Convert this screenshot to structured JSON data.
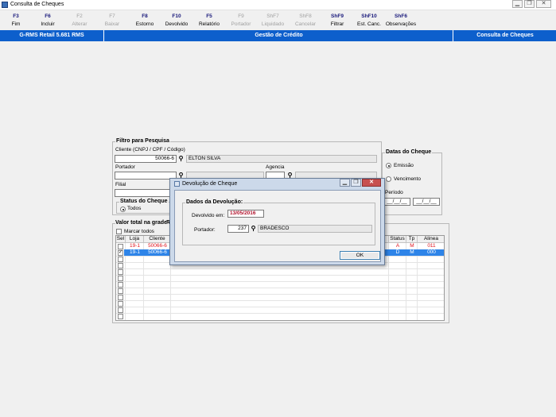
{
  "window": {
    "title": "Consulta de Cheques",
    "buttons": [
      "▁",
      "❐",
      "✕"
    ]
  },
  "toolbar": [
    {
      "key": "F3",
      "label": "Fim",
      "enabled": true
    },
    {
      "key": "F6",
      "label": "Incluir",
      "enabled": true
    },
    {
      "key": "F2",
      "label": "Alterar",
      "enabled": false
    },
    {
      "key": "F7",
      "label": "Baixar",
      "enabled": false
    },
    {
      "key": "F8",
      "label": "Estorno",
      "enabled": true
    },
    {
      "key": "F10",
      "label": "Devolvido",
      "enabled": true
    },
    {
      "key": "F5",
      "label": "Relatório",
      "enabled": true
    },
    {
      "key": "F9",
      "label": "Portador",
      "enabled": false
    },
    {
      "key": "ShF7",
      "label": "Liquidado",
      "enabled": false
    },
    {
      "key": "ShF8",
      "label": "Cancelar",
      "enabled": false
    },
    {
      "key": "ShF9",
      "label": "Filtrar",
      "enabled": true
    },
    {
      "key": "ShF10",
      "label": "Est. Canc.",
      "enabled": true
    },
    {
      "key": "ShF6",
      "label": "Observações",
      "enabled": true
    }
  ],
  "header": {
    "left": "G-RMS Retail 5.681 RMS",
    "center": "Gestão de Crédito",
    "right": "Consulta de Cheques"
  },
  "filter": {
    "title": "Filtro para Pesquisa",
    "cliente_label": "Cliente (CNPJ / CPF / Código)",
    "cliente_value": "50066-6",
    "cliente_name": "ELTON SILVA",
    "portador_label": "Portador",
    "agencia_label": "Agencia",
    "filial_label": "Filial",
    "status_title": "Status do Cheque",
    "status_option": "Todos"
  },
  "datas": {
    "title": "Datas do Cheque",
    "option_emissao": "Emissão",
    "option_vencimento": "Vencimento",
    "periodo_label": "Período",
    "date_from": "__/__/__",
    "date_to": "__/__/__"
  },
  "grid_section": {
    "total_label": "Valor total na grade:",
    "total_value": "R",
    "marcar_todos": "Marcar todos",
    "columns": {
      "sel": "Sel",
      "loja": "Loja",
      "cliente": "Cliente",
      "status": "Status",
      "tp": "Tp",
      "alinea": "Alinea"
    },
    "rows": [
      {
        "checked": false,
        "loja": "19-1",
        "cliente": "50066-6",
        "status": "A",
        "tp": "M",
        "alinea": "011"
      },
      {
        "checked": true,
        "loja": "19-1",
        "cliente": "50066-6",
        "status": "D",
        "tp": "M",
        "alinea": "000"
      }
    ]
  },
  "dialog": {
    "title": "Devolução de Cheque",
    "group_title": "Dados da Devolução:",
    "devolvido_label": "Devolvido em:",
    "devolvido_value": "13/05/2016",
    "portador_label": "Portador:",
    "portador_code": "237",
    "portador_name": "BRADESCO",
    "ok_label": "OK",
    "buttons": [
      "▁",
      "❐",
      "✕"
    ]
  },
  "colors": {
    "accent_blue": "#0d5fcc",
    "selection_blue": "#2e84e8",
    "red_text": "#e0141e",
    "date_text": "#b0102a",
    "toolbar_key": "#17177a"
  }
}
